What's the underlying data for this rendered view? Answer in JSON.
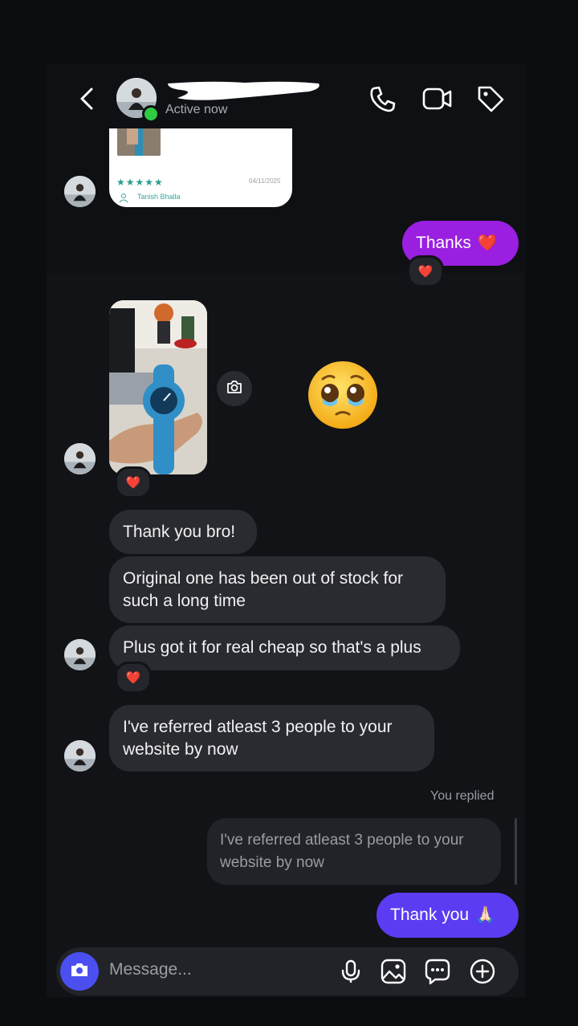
{
  "header": {
    "status": "Active now",
    "icons": [
      "back-icon",
      "phone-icon",
      "video-icon",
      "tag-icon"
    ]
  },
  "shared_post": {
    "stars": "★★★★★",
    "date": "04/11/2025",
    "reviewer": "Tanish Bhalla"
  },
  "messages": {
    "thanks": "Thanks",
    "thanks_emoji": "❤️",
    "reaction_heart": "❤️",
    "thank_you_bro": "Thank you bro!",
    "original_one": "Original one has been out of stock for such a long time",
    "plus_cheap": "Plus got it for real cheap so that's a plus",
    "referred": "I've referred atleast 3 people to your website by now",
    "you_replied": "You replied",
    "quoted": "I've referred atleast 3 people to your website by now",
    "thank_you": "Thank you",
    "thank_you_emoji": "🙏🏻"
  },
  "composer": {
    "placeholder": "Message...",
    "icons": [
      "camera-icon",
      "microphone-icon",
      "gallery-icon",
      "sticker-icon",
      "plus-icon"
    ]
  },
  "colors": {
    "outgoing_purple": "#9a1fe0",
    "outgoing_blue": "#5b3cf2",
    "incoming": "#2a2b30",
    "online": "#2ecc40"
  }
}
